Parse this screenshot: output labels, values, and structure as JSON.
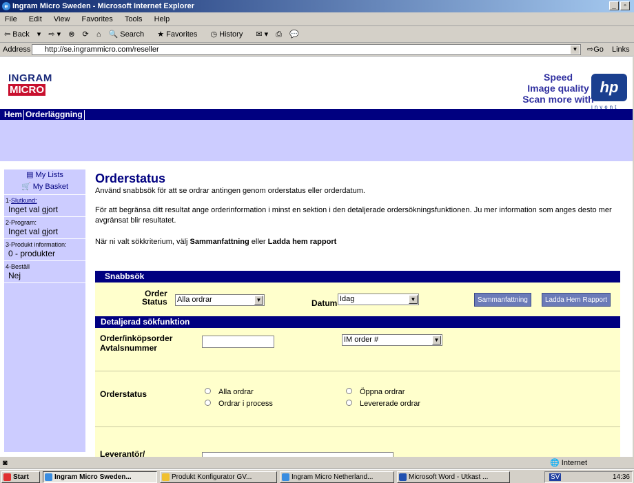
{
  "window": {
    "title": "Ingram Micro Sweden - Microsoft Internet Explorer"
  },
  "menu": [
    "File",
    "Edit",
    "View",
    "Favorites",
    "Tools",
    "Help"
  ],
  "toolbar": {
    "back": "Back",
    "search": "Search",
    "favorites": "Favorites",
    "history": "History"
  },
  "address": {
    "label": "Address",
    "url": "http://se.ingrammicro.com/reseller",
    "go": "Go",
    "links": "Links"
  },
  "logo": {
    "line1": "INGRAM",
    "line2": "MICRO"
  },
  "banner": {
    "line1": "Speed",
    "line2": "Image quality",
    "line3": "Scan more with",
    "brand": "invent"
  },
  "nav": {
    "home": "Hem",
    "order": "Orderläggning"
  },
  "sidebar": {
    "my_lists": "My Lists",
    "my_basket": "My Basket",
    "steps": [
      {
        "label": "1-",
        "link": "Slutkund:",
        "value": "Inget val gjort"
      },
      {
        "label": "2-Program:",
        "value": "Inget val gjort"
      },
      {
        "label": "3-Produkt information:",
        "value": "0 - produkter"
      },
      {
        "label": "4-Beställ",
        "value": "Nej"
      }
    ]
  },
  "main": {
    "title": "Orderstatus",
    "intro": "Använd snabbsök för att se ordrar antingen genom orderstatus eller orderdatum.",
    "para2": "För att begränsa ditt resultat ange orderinformation i minst en sektion i den detaljerade ordersökningsfunktionen. Ju mer information som anges desto mer avgränsat blir resultatet.",
    "para3_pre": "När ni valt sökkriterium, välj ",
    "para3_b1": "Sammanfattning",
    "para3_mid": " eller ",
    "para3_b2": "Ladda hem rapport"
  },
  "quick": {
    "header": "Snabbsök",
    "order_label1": "Order",
    "order_label2": "Status",
    "status_value": "Alla ordrar",
    "date_label": "Datum",
    "date_value": "Idag",
    "summary_btn": "Sammanfattning",
    "download_btn": "Ladda Hem Rapport"
  },
  "detail": {
    "header": "Detaljerad sökfunktion",
    "order_label1": "Order/inköpsorder",
    "order_label2": "Avtalsnummer",
    "order_input": "",
    "ordertype_value": "IM order #",
    "status_label": "Orderstatus",
    "radios": [
      "Alla ordrar",
      "Ordrar i process",
      "Öppna ordrar",
      "Levererade ordrar"
    ],
    "supplier_label": "Leverantör/"
  },
  "status": {
    "zone": "Internet"
  },
  "taskbar": {
    "start": "Start",
    "tasks": [
      "Ingram Micro Sweden...",
      "Produkt Konfigurator GV...",
      "Ingram Micro Netherland...",
      "Microsoft Word - Utkast ..."
    ],
    "lang": "SV",
    "clock": "14:36"
  }
}
